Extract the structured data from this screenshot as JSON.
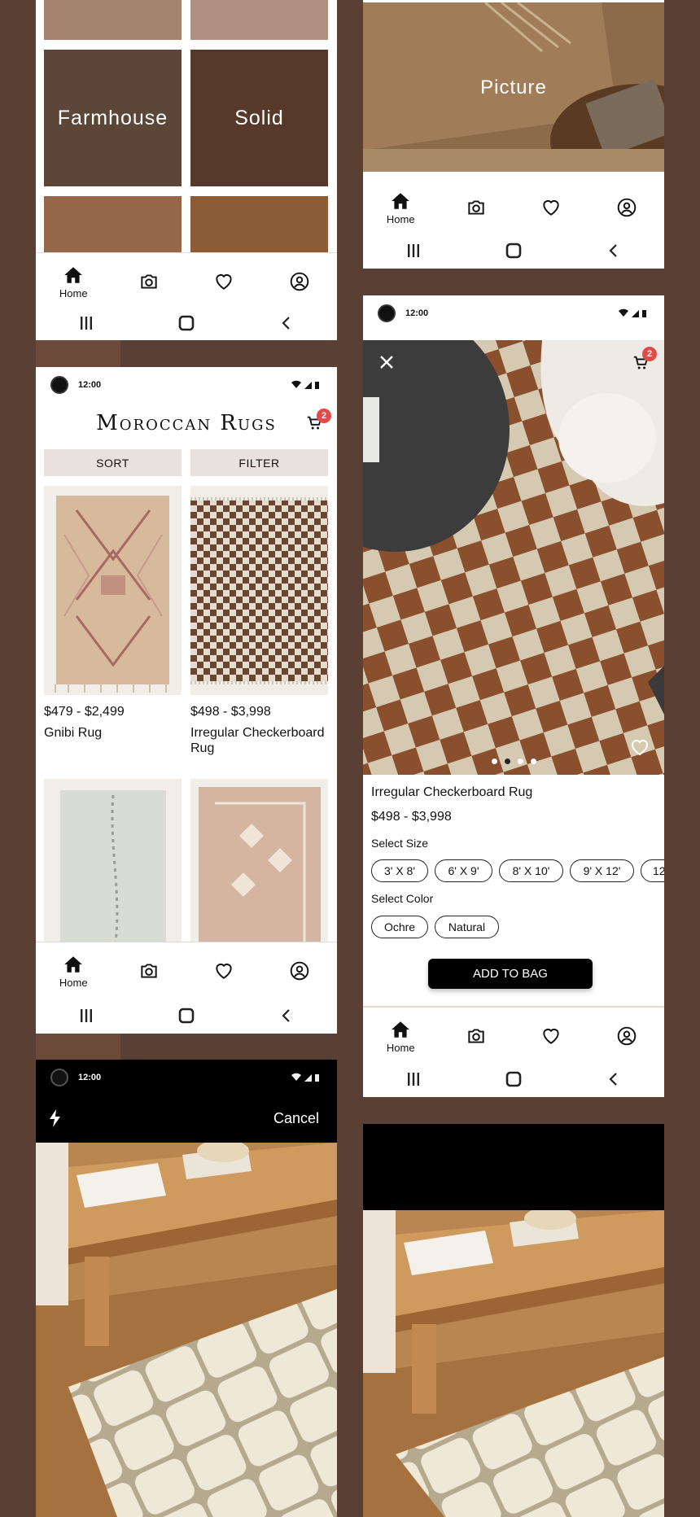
{
  "categories": {
    "tiles": [
      {
        "label": "Farmhouse",
        "color": "#5c4638"
      },
      {
        "label": "Solid",
        "color": "#56392a"
      }
    ],
    "picture_tile_label": "Picture"
  },
  "status": {
    "time": "12:00"
  },
  "nav": {
    "home_label": "Home"
  },
  "listing": {
    "title": "Moroccan Rugs",
    "cart_count": "2",
    "sort_label": "SORT",
    "filter_label": "FILTER",
    "products": [
      {
        "price": "$479 - $2,499",
        "name": "Gnibi Rug"
      },
      {
        "price": "$498 - $3,998",
        "name": "Irregular Checkerboard Rug"
      }
    ]
  },
  "product": {
    "cart_count": "2",
    "name": "Irregular Checkerboard Rug",
    "price": "$498 - $3,998",
    "select_size_label": "Select Size",
    "sizes": [
      "3' X 8'",
      "6' X 9'",
      "8' X 10'",
      "9' X 12'",
      "12"
    ],
    "select_color_label": "Select Color",
    "colors": [
      "Ochre",
      "Natural"
    ],
    "add_to_bag_label": "ADD TO BAG",
    "carousel": {
      "count": 4,
      "active_index": 1
    }
  },
  "camera": {
    "cancel_label": "Cancel"
  },
  "icons": [
    "home-icon",
    "camera-icon",
    "heart-icon",
    "profile-icon",
    "cart-icon",
    "close-icon",
    "flash-icon",
    "recents-icon",
    "home-square-icon",
    "back-icon"
  ],
  "colors": {
    "accent_badge": "#e24a4a",
    "sort_bg": "#e9e1dd",
    "background": "#5a4034"
  }
}
